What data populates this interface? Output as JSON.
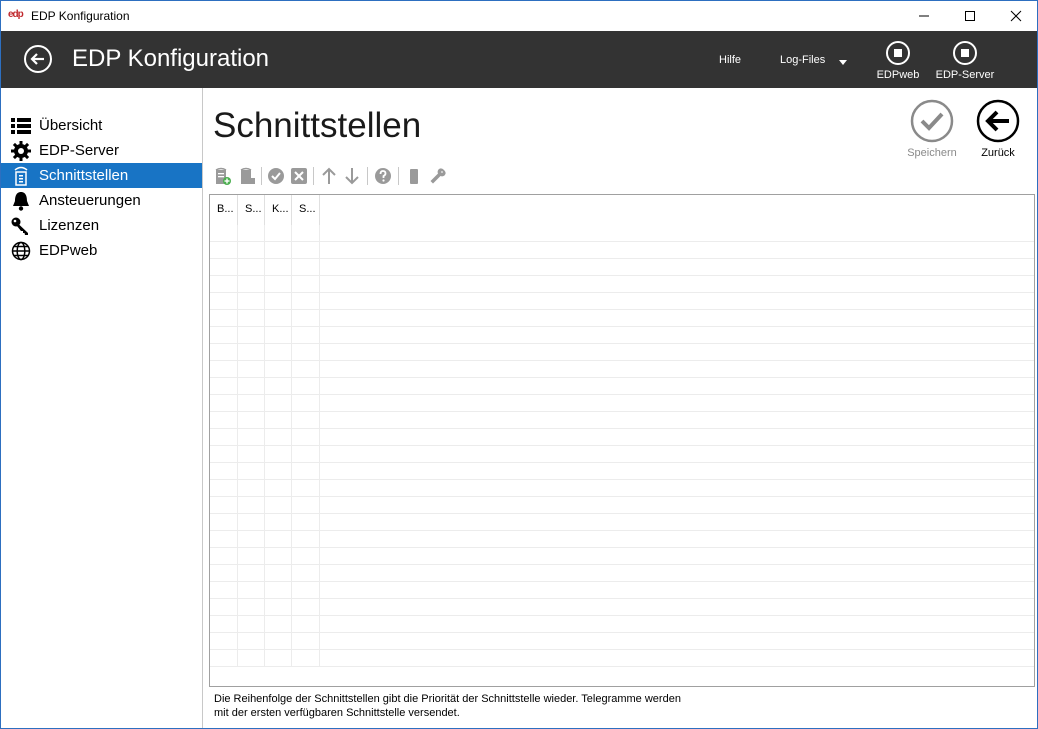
{
  "window": {
    "logo_text": "edp",
    "title": "EDP Konfiguration",
    "controls": [
      "minimize-icon",
      "maximize-icon",
      "close-icon"
    ]
  },
  "header": {
    "title": "EDP Konfiguration",
    "help_label": "Hilfe",
    "logfiles_label": "Log-Files",
    "edpweb_label": "EDPweb",
    "edpserver_label": "EDP-Server",
    "background": "#333333"
  },
  "sidebar": {
    "items": [
      {
        "label": "Übersicht",
        "icon": "list-icon"
      },
      {
        "label": "EDP-Server",
        "icon": "gear-icon"
      },
      {
        "label": "Schnittstellen",
        "icon": "interface-icon",
        "active": true
      },
      {
        "label": "Ansteuerungen",
        "icon": "bell-icon"
      },
      {
        "label": "Lizenzen",
        "icon": "key-icon"
      },
      {
        "label": "EDPweb",
        "icon": "globe-icon"
      }
    ],
    "active_color": "#1874c5"
  },
  "main": {
    "title": "Schnittstellen",
    "save_label": "Speichern",
    "back_label": "Zurück",
    "toolbar": [
      "add-interface-icon",
      "edit-interface-icon",
      "enable-icon",
      "disable-icon",
      "move-up-icon",
      "move-down-icon",
      "help-icon",
      "device-icon",
      "configure-icon"
    ],
    "table": {
      "columns": [
        "B...",
        "S...",
        "K...",
        "S..."
      ],
      "rows": []
    },
    "hint_line1": "Die Reihenfolge der Schnittstellen gibt die Priorität der Schnittstelle wieder. Telegramme werden",
    "hint_line2": "mit der ersten verfügbaren Schnittstelle versendet."
  }
}
